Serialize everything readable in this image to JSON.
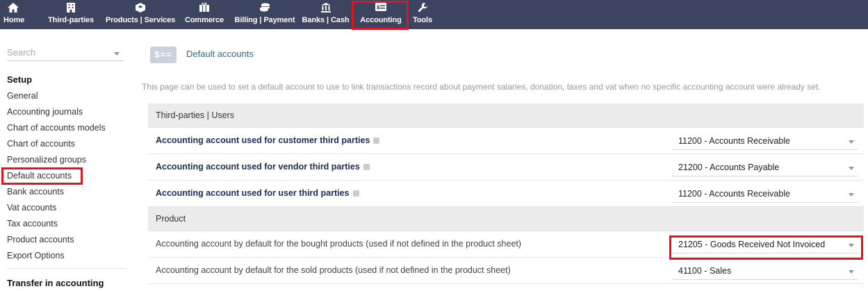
{
  "topmenu": {
    "items": [
      {
        "label": "Home",
        "icon": "home-icon"
      },
      {
        "label": "Third-parties",
        "icon": "building-icon"
      },
      {
        "label": "Products | Services",
        "icon": "cube-icon"
      },
      {
        "label": "Commerce",
        "icon": "briefcase-icon"
      },
      {
        "label": "Billing | Payment",
        "icon": "coins-icon"
      },
      {
        "label": "Banks | Cash",
        "icon": "bank-icon"
      },
      {
        "label": "Accounting",
        "icon": "accounting-icon"
      },
      {
        "label": "Tools",
        "icon": "wrench-icon"
      }
    ],
    "active": "Accounting"
  },
  "sidebar": {
    "search_placeholder": "Search",
    "setup_title": "Setup",
    "items": [
      "General",
      "Accounting journals",
      "Chart of accounts models",
      "Chart of accounts",
      "Personalized groups",
      "Default accounts",
      "Bank accounts",
      "Vat accounts",
      "Tax accounts",
      "Product accounts",
      "Export Options"
    ],
    "transfer_title": "Transfer in accounting"
  },
  "main": {
    "icon_text": "$==",
    "title": "Default accounts",
    "description": "This page can be used to set a default account to use to link transactions record about payment salaries, donation, taxes and vat when no specific accounting account were already set.",
    "sections": [
      {
        "title": "Third-parties | Users",
        "rows": [
          {
            "label": "Accounting account used for customer third parties",
            "value": "11200 - Accounts Receivable"
          },
          {
            "label": "Accounting account used for vendor third parties",
            "value": "21200 - Accounts Payable"
          },
          {
            "label": "Accounting account used for user third parties",
            "value": "11200 - Accounts Receivable"
          }
        ]
      },
      {
        "title": "Product",
        "rows": [
          {
            "label": "Accounting account by default for the bought products (used if not defined in the product sheet)",
            "value": "21205 - Goods Received Not Invoiced"
          },
          {
            "label": "Accounting account by default for the sold products (used if not defined in the product sheet)",
            "value": "41100 - Sales"
          }
        ]
      }
    ]
  },
  "colors": {
    "topbar": "#3d4460",
    "highlight": "#e0151d",
    "title": "#2a6d8a",
    "strong_label": "#1c2a5c"
  }
}
